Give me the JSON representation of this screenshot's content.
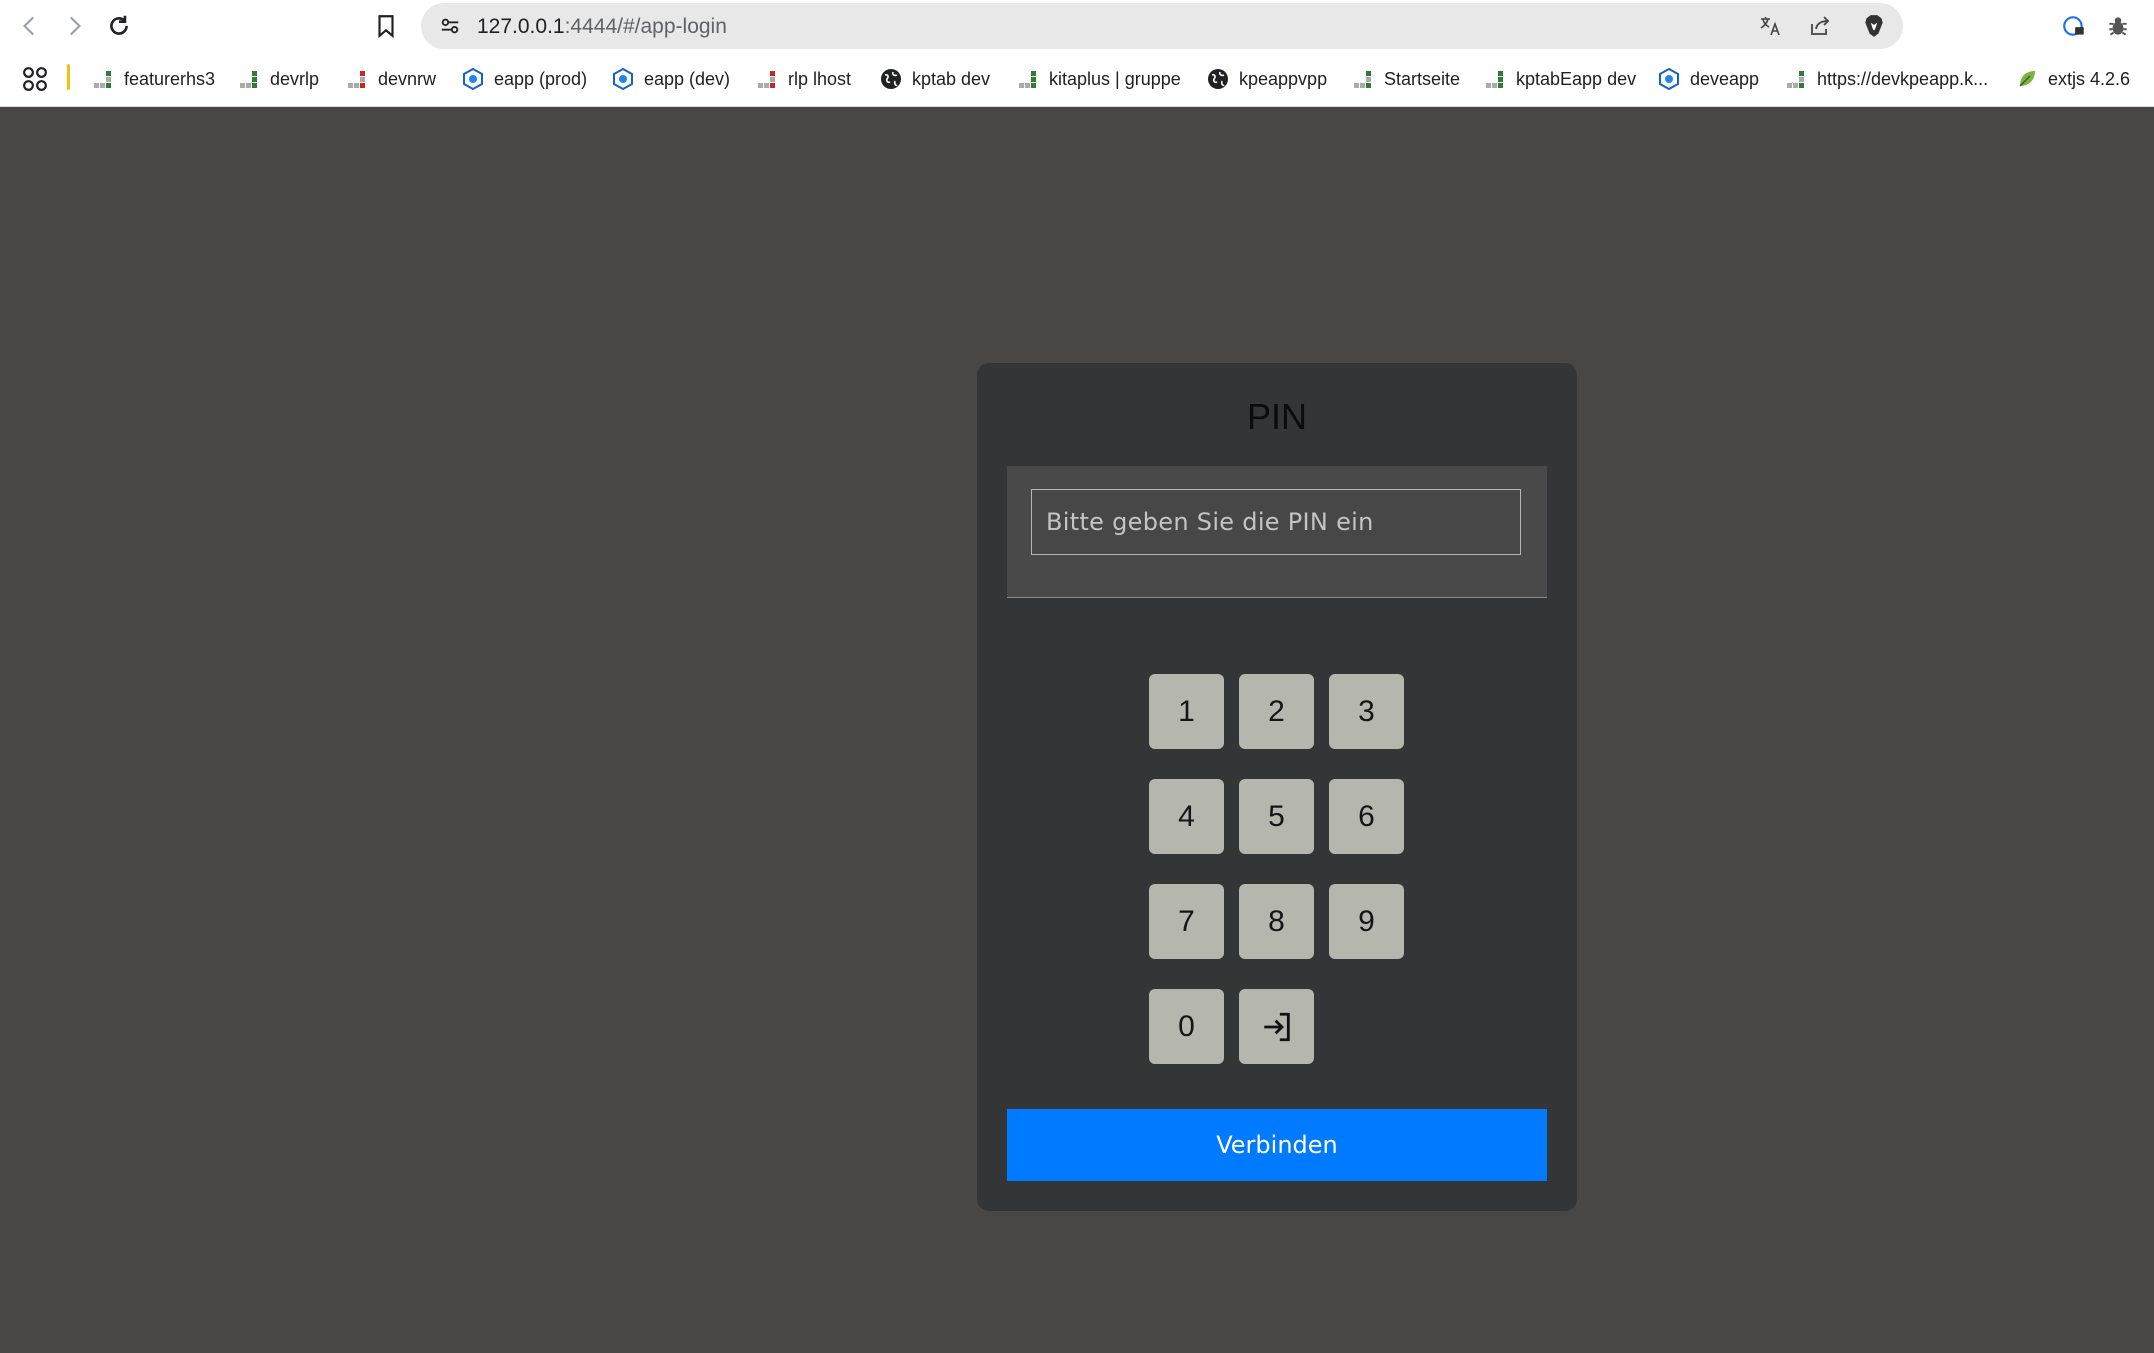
{
  "browser": {
    "url_host": "127.0.0.1",
    "url_path": ":4444/#/app-login",
    "bookmarks": [
      {
        "label": "featurerhs3",
        "icon": "bars-icon"
      },
      {
        "label": "devrlp",
        "icon": "bars-icon"
      },
      {
        "label": "devnrw",
        "icon": "bars-icon"
      },
      {
        "label": "eapp (prod)",
        "icon": "hex-logo-icon"
      },
      {
        "label": "eapp (dev)",
        "icon": "hex-logo-icon"
      },
      {
        "label": "rlp lhost",
        "icon": "bars-icon"
      },
      {
        "label": "kptab dev",
        "icon": "globe-icon"
      },
      {
        "label": "kitaplus | gruppe",
        "icon": "bars-icon"
      },
      {
        "label": "kpeappvpp",
        "icon": "globe-icon"
      },
      {
        "label": "Startseite",
        "icon": "bars-icon"
      },
      {
        "label": "kptabEapp dev",
        "icon": "bars-icon"
      },
      {
        "label": "deveapp",
        "icon": "hex-logo-icon"
      },
      {
        "label": "https://devkpeapp.k...",
        "icon": "bars-icon"
      },
      {
        "label": "extjs 4.2.6",
        "icon": "leaf-icon"
      }
    ]
  },
  "login": {
    "title": "PIN",
    "pin_placeholder": "Bitte geben Sie die PIN ein",
    "keys": [
      "1",
      "2",
      "3",
      "4",
      "5",
      "6",
      "7",
      "8",
      "9",
      "0"
    ],
    "enter_icon": "login-arrow-icon",
    "connect_label": "Verbinden"
  },
  "colors": {
    "page_background": "#484745",
    "card_background": "#343537",
    "key_background": "#b5b7af",
    "connect_button": "#007bff"
  }
}
